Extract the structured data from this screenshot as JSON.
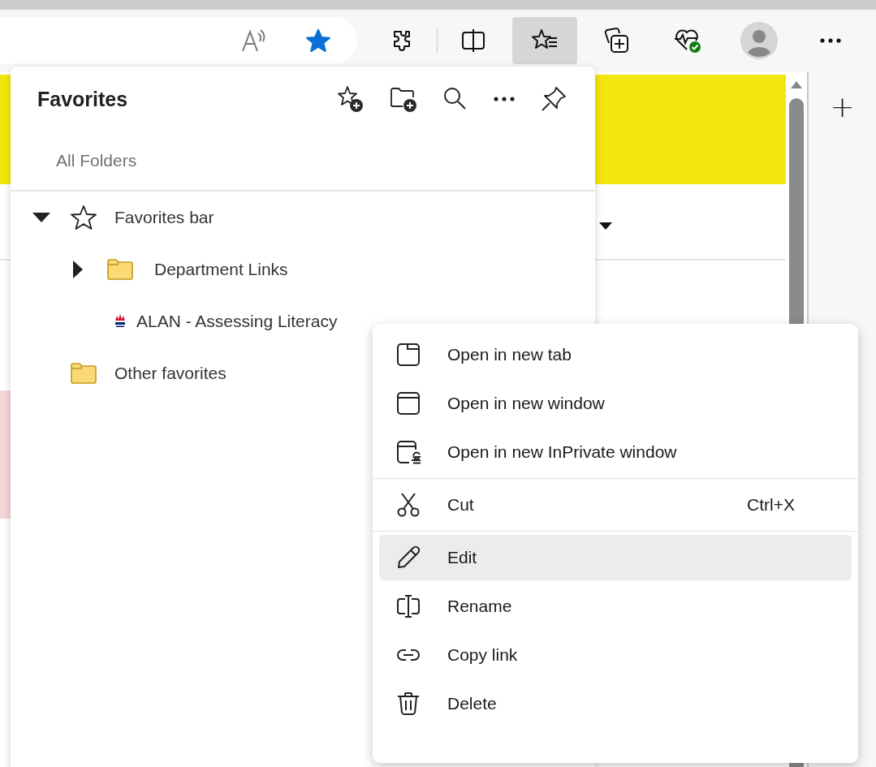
{
  "toolbar": {
    "address_icons": [
      {
        "kind": "read-aloud"
      },
      {
        "kind": "favorite-star",
        "selected": true
      }
    ],
    "buttons": [
      {
        "kind": "extensions",
        "selected": false
      },
      {
        "kind": "split-screen",
        "selected": false
      },
      {
        "kind": "favorites",
        "selected": true
      },
      {
        "kind": "collections",
        "selected": false
      },
      {
        "kind": "health",
        "selected": false
      },
      {
        "kind": "profile",
        "selected": false
      },
      {
        "kind": "more",
        "selected": false
      }
    ]
  },
  "side_rail": {
    "new_tab": "+"
  },
  "favorites_panel": {
    "title": "Favorites",
    "breadcrumb": "All Folders",
    "tree": [
      {
        "label": "Favorites bar",
        "kind": "root",
        "expanded": true,
        "children": [
          {
            "label": "Department Links",
            "kind": "folder",
            "expanded": false
          },
          {
            "label": "ALAN - Assessing Literacy",
            "kind": "link"
          }
        ]
      },
      {
        "label": "Other favorites",
        "kind": "folder"
      }
    ]
  },
  "context_menu": {
    "groups": [
      [
        {
          "label": "Open in new tab",
          "kind": "new-tab",
          "selected": false
        },
        {
          "label": "Open in new window",
          "kind": "new-window",
          "selected": false
        },
        {
          "label": "Open in new InPrivate window",
          "kind": "inprivate",
          "selected": false
        }
      ],
      [
        {
          "label": "Cut",
          "kind": "cut",
          "shortcut": "Ctrl+X",
          "selected": false
        }
      ],
      [
        {
          "label": "Edit",
          "kind": "edit",
          "selected": true
        },
        {
          "label": "Rename",
          "kind": "rename",
          "selected": false
        },
        {
          "label": "Copy link",
          "kind": "copy-link",
          "selected": false
        },
        {
          "label": "Delete",
          "kind": "delete",
          "selected": false
        }
      ]
    ]
  }
}
